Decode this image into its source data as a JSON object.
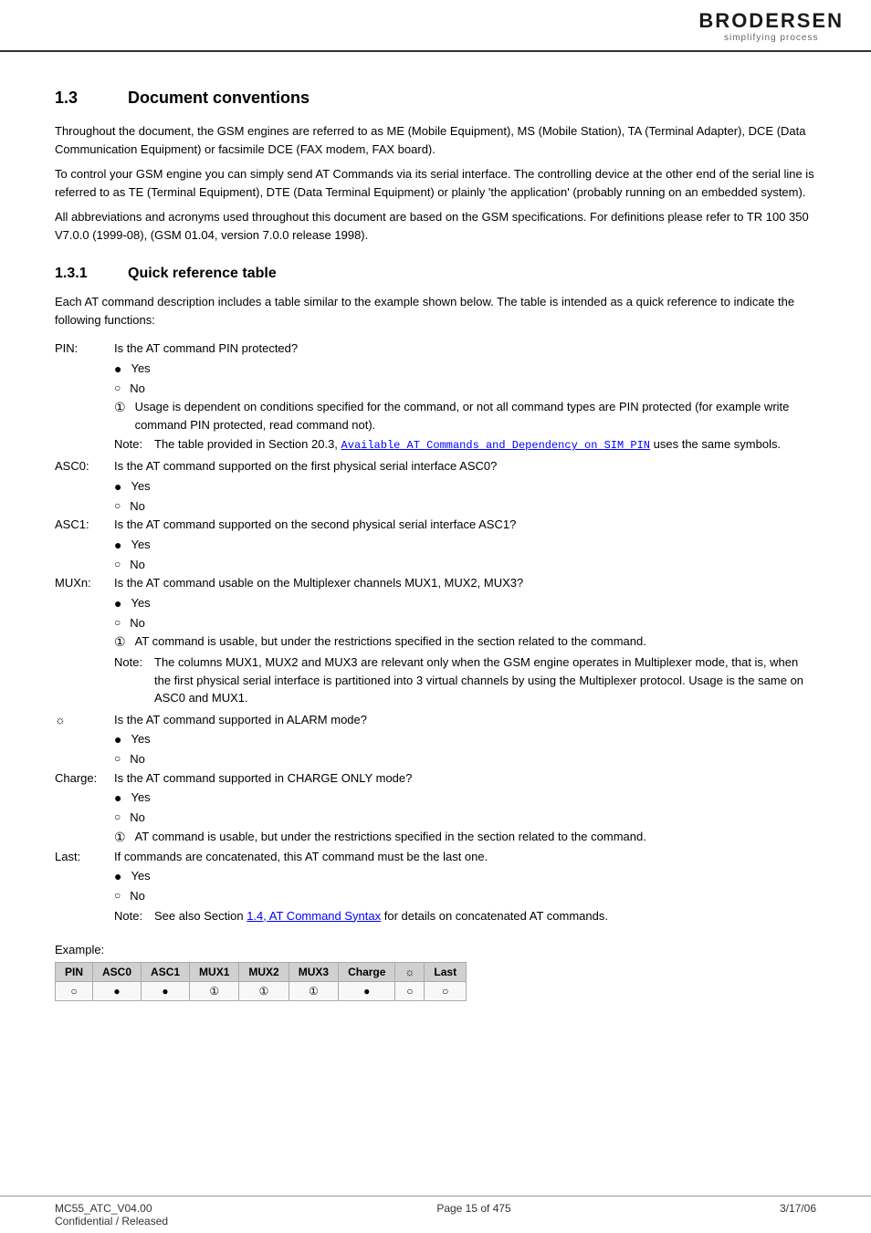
{
  "header": {
    "logo_name": "BRODERSEN",
    "logo_sub": "simplifying process"
  },
  "section_1_3": {
    "num": "1.3",
    "title": "Document conventions",
    "paragraph1": "Throughout the document, the GSM engines are referred to as ME (Mobile Equipment), MS (Mobile Station), TA (Terminal Adapter), DCE (Data Communication Equipment) or facsimile DCE (FAX modem, FAX board).",
    "paragraph2": "To control your GSM engine you can simply send AT Commands via its serial interface. The controlling device at the other end of the serial line is referred to as TE (Terminal Equipment), DTE (Data Terminal Equipment) or plainly 'the application' (probably running on an embedded system).",
    "paragraph3": "All abbreviations and acronyms used throughout this document are based on the GSM specifications. For definitions please refer to TR 100 350 V7.0.0 (1999-08), (GSM 01.04, version 7.0.0 release 1998)."
  },
  "section_1_3_1": {
    "num": "1.3.1",
    "title": "Quick reference table",
    "intro": "Each AT command description includes a table similar to the example shown below. The table is intended as a quick reference to indicate the following functions:",
    "definitions": [
      {
        "term": "PIN:",
        "desc": "Is the AT command PIN protected?"
      },
      {
        "term": "ASC0:",
        "desc": "Is the AT command supported on the first physical serial interface ASC0?"
      },
      {
        "term": "ASC1:",
        "desc": "Is the AT command supported on the second physical serial interface ASC1?"
      },
      {
        "term": "MUXn:",
        "desc": "Is the AT command usable on the Multiplexer channels MUX1, MUX2, MUX3?"
      },
      {
        "term": "alarm",
        "desc": "Is the AT command supported in ALARM mode?"
      },
      {
        "term": "Charge:",
        "desc": "Is the AT command supported in CHARGE ONLY mode?"
      },
      {
        "term": "Last:",
        "desc": "If commands are concatenated, this AT command must be the last one."
      }
    ],
    "yes_label": "Yes",
    "no_label": "No",
    "usage_dep_label": "Usage is dependent on conditions specified for the command, or not all command types are PIN protected (for example write command PIN protected, read command not).",
    "note_pin": "The table provided in Section 20.3,",
    "note_pin_link": "Available AT Commands and Dependency on SIM PIN",
    "note_pin_end": "uses the same symbols.",
    "muxn_half_desc": "AT command is usable, but under the restrictions specified in the section related to the command.",
    "muxn_note": "The columns MUX1, MUX2 and MUX3 are relevant only when the GSM engine operates in Multiplexer mode, that is, when the first physical serial interface is partitioned into 3 virtual channels by using the Multiplexer protocol. Usage is the same on ASC0 and MUX1.",
    "charge_half_desc": "AT command is usable, but under the restrictions specified in the section related to the command.",
    "last_note_pre": "See also Section",
    "last_note_link": "1.4, AT Command Syntax",
    "last_note_end": "for details on concatenated AT commands.",
    "example_label": "Example:"
  },
  "table": {
    "headers": [
      "PIN",
      "ASC0",
      "ASC1",
      "MUX1",
      "MUX2",
      "MUX3",
      "Charge",
      "☼",
      "Last"
    ],
    "row": [
      "○",
      "●",
      "●",
      "①",
      "①",
      "①",
      "●",
      "○",
      "○"
    ]
  },
  "footer": {
    "left_line1": "MC55_ATC_V04.00",
    "left_line2": "Confidential / Released",
    "center": "Page 15 of 475",
    "right": "3/17/06"
  }
}
